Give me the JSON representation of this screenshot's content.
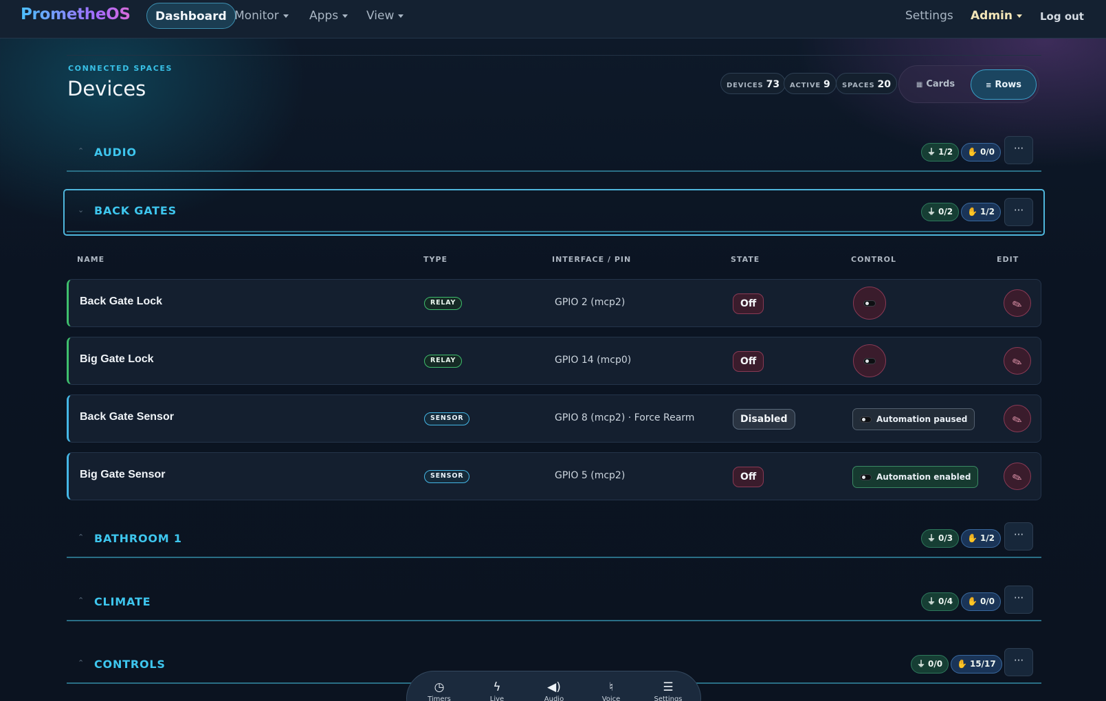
{
  "nav": {
    "brand": "PrometheOS",
    "dashboard": "Dashboard",
    "monitor": "Monitor",
    "apps": "Apps",
    "view": "View",
    "settings": "Settings",
    "admin": "Admin",
    "logout": "Log out"
  },
  "header": {
    "eyebrow": "CONNECTED SPACES",
    "title": "Devices",
    "stats": [
      {
        "label": "DEVICES",
        "value": "73"
      },
      {
        "label": "ACTIVE",
        "value": "9"
      },
      {
        "label": "SPACES",
        "value": "20"
      }
    ],
    "view_toggle": {
      "cards": "Cards",
      "rows": "Rows",
      "selected": "Rows"
    }
  },
  "sections": [
    {
      "title": "AUDIO",
      "relay_count": "1/2",
      "manual_count": "0/0",
      "expanded": false
    },
    {
      "title": "BACK GATES",
      "relay_count": "0/2",
      "manual_count": "1/2",
      "expanded": true
    },
    {
      "title": "BATHROOM 1",
      "relay_count": "0/3",
      "manual_count": "1/2",
      "expanded": false
    },
    {
      "title": "CLIMATE",
      "relay_count": "0/4",
      "manual_count": "0/0",
      "expanded": false
    },
    {
      "title": "CONTROLS",
      "relay_count": "0/0",
      "manual_count": "15/17",
      "expanded": false
    }
  ],
  "more_label": "···",
  "table": {
    "columns": [
      "NAME",
      "TYPE",
      "INTERFACE / PIN",
      "STATE",
      "CONTROL",
      "EDIT"
    ],
    "rows": [
      {
        "name": "Back Gate Lock",
        "type": "RELAY",
        "interface": "GPIO 2 (mcp2)",
        "state": "Off",
        "control": "toggle"
      },
      {
        "name": "Big Gate Lock",
        "type": "RELAY",
        "interface": "GPIO 14 (mcp0)",
        "state": "Off",
        "control": "toggle"
      },
      {
        "name": "Back Gate Sensor",
        "type": "SENSOR",
        "interface": "GPIO 8 (mcp2) · Force Rearm",
        "state": "Disabled",
        "control": "Automation paused"
      },
      {
        "name": "Big Gate Sensor",
        "type": "SENSOR",
        "interface": "GPIO 5 (mcp2)",
        "state": "Off",
        "control": "Automation enabled"
      }
    ]
  },
  "dock": {
    "items": [
      {
        "label": "Timers",
        "icon": "clock-icon"
      },
      {
        "label": "Live",
        "icon": "bolt-icon"
      },
      {
        "label": "Audio",
        "icon": "speaker-icon"
      },
      {
        "label": "Voice",
        "icon": "microphone-icon"
      },
      {
        "label": "Settings",
        "icon": "sliders-icon"
      }
    ]
  },
  "colors": {
    "accent": "#3ec6ee",
    "relay": "#3fbf6d",
    "sensor": "#45b7e6",
    "off": "#8a3a55"
  }
}
